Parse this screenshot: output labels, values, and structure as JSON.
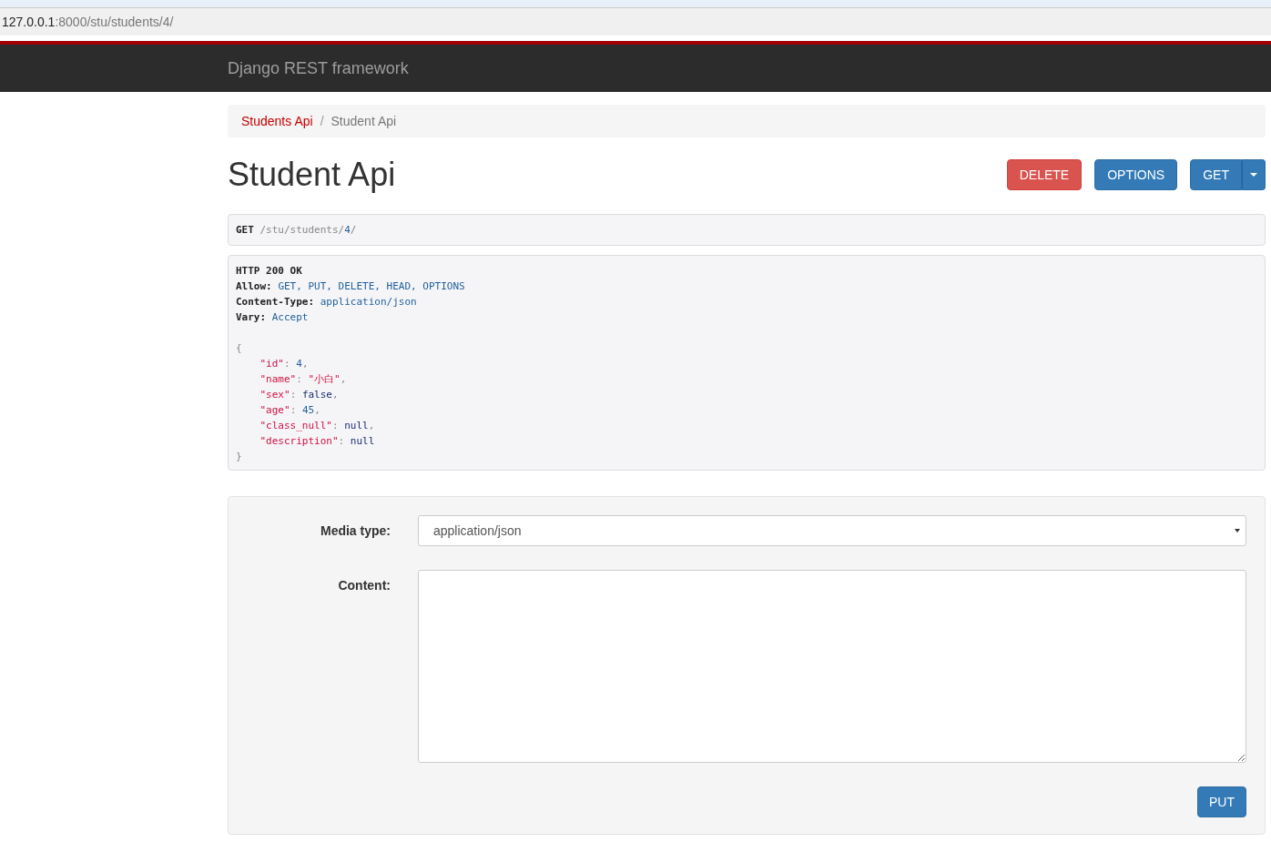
{
  "address_bar": {
    "host": "127.0.0.1",
    "rest": ":8000/stu/students/4/"
  },
  "navbar": {
    "brand": "Django REST framework"
  },
  "breadcrumbs": [
    {
      "label": "Students Api",
      "selected": false
    },
    {
      "label": "Student Api",
      "selected": true
    }
  ],
  "breadcrumb_separator": "/",
  "title": "Student Api",
  "actions": [
    {
      "label": "DELETE",
      "kind": "danger"
    },
    {
      "label": "OPTIONS",
      "kind": "primary"
    },
    {
      "label": "GET",
      "kind": "split"
    }
  ],
  "request": {
    "method": "GET",
    "path": "/stu/students/",
    "id": "4",
    "trail": "/"
  },
  "response": {
    "status": "HTTP 200 OK",
    "headers": [
      {
        "name": "Allow:",
        "value": "GET, PUT, DELETE, HEAD, OPTIONS"
      },
      {
        "name": "Content-Type:",
        "value": "application/json"
      },
      {
        "name": "Vary:",
        "value": "Accept"
      }
    ],
    "open": "{",
    "close": "}",
    "fields": [
      {
        "key": "\"id\"",
        "sep": ": ",
        "value": "4",
        "kind": "number",
        "end": ","
      },
      {
        "key": "\"name\"",
        "sep": ": ",
        "value": "\"小白\"",
        "kind": "string",
        "end": ","
      },
      {
        "key": "\"sex\"",
        "sep": ": ",
        "value": "false",
        "kind": "literal",
        "end": ","
      },
      {
        "key": "\"age\"",
        "sep": ": ",
        "value": "45",
        "kind": "number",
        "end": ","
      },
      {
        "key": "\"class_null\"",
        "sep": ": ",
        "value": "null",
        "kind": "literal",
        "end": ","
      },
      {
        "key": "\"description\"",
        "sep": ": ",
        "value": "null",
        "kind": "literal"
      }
    ]
  },
  "form": {
    "media_label": "Media type:",
    "media_value": "application/json",
    "content_label": "Content:",
    "submit": "PUT"
  }
}
